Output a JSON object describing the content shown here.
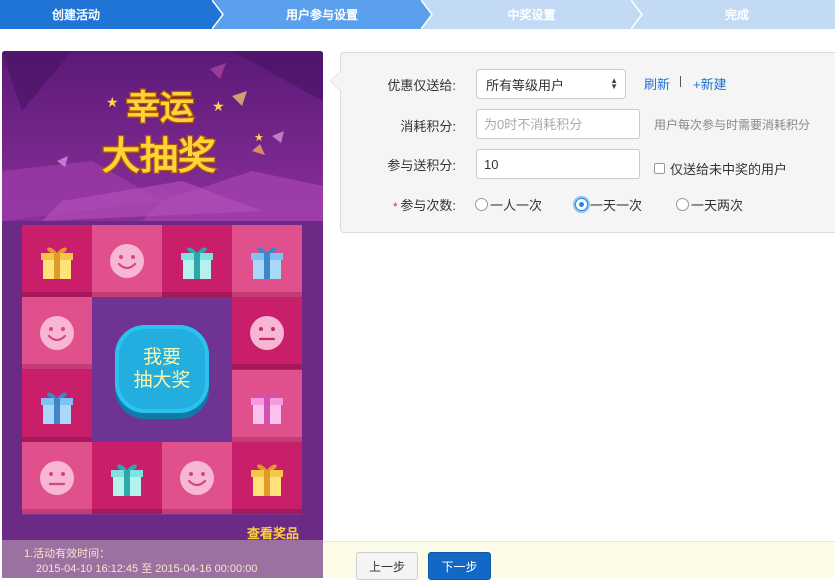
{
  "steps": [
    "创建活动",
    "用户参与设置",
    "中奖设置",
    "完成"
  ],
  "preview": {
    "title_line1": "幸运",
    "title_line2": "大抽奖",
    "draw_button_line1": "我要",
    "draw_button_line2": "抽大奖",
    "view_prizes": "查看奖品",
    "validity_label": "1.活动有效时间：",
    "validity_range": "2015-04-10 16:12:45 至 2015-04-16 00:00:00"
  },
  "form": {
    "send_to_label": "优惠仅送给:",
    "send_to_value": "所有等级用户",
    "refresh_link": "刷新",
    "new_link": "+新建",
    "consume_label": "消耗积分:",
    "consume_placeholder": "为0时不消耗积分",
    "consume_hint": "用户每次参与时需要消耗积分",
    "reward_label": "参与送积分:",
    "reward_value": "10",
    "only_non_winners": "仅送给未中奖的用户",
    "times_required": "*",
    "times_label": "参与次数:",
    "times_options": [
      "一人一次",
      "一天一次",
      "一天两次"
    ],
    "times_selected": "一天一次"
  },
  "footer": {
    "prev_label": "上一步",
    "next_label": "下一步"
  },
  "colors": {
    "step_done": "#1f74d6",
    "step_active": "#5aa0ec",
    "step_todo": "#c3daf5",
    "primary": "#1268c4",
    "link": "#1e6fd6",
    "lottery_bg": "#6b2a86",
    "cell_dark": "#c91f6b",
    "cell_light": "#e0508d",
    "draw_button": "#23aee0"
  },
  "icons": [
    "gift-icon",
    "smiley-icon",
    "neutral-face-icon",
    "dropdown-caret-icon"
  ]
}
